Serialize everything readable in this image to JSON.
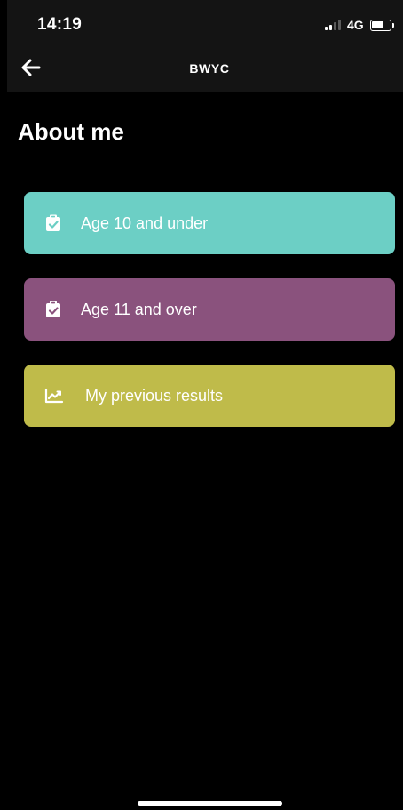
{
  "status_bar": {
    "time": "14:19",
    "network": "4G",
    "battery_level_percent": 70
  },
  "nav_bar": {
    "back_icon": "arrow-left-icon",
    "title": "BWYC"
  },
  "page": {
    "title": "About me"
  },
  "menu": [
    {
      "label": "Age 10 and under",
      "icon": "clipboard-check-icon",
      "color": "#6ccfc5"
    },
    {
      "label": "Age 11 and over",
      "icon": "clipboard-check-icon",
      "color": "#8a527d"
    },
    {
      "label": "My previous results",
      "icon": "trending-up-icon",
      "color": "#bfbb4a"
    }
  ],
  "colors": {
    "background": "#000000",
    "header_background": "#141414",
    "text": "#ffffff"
  }
}
